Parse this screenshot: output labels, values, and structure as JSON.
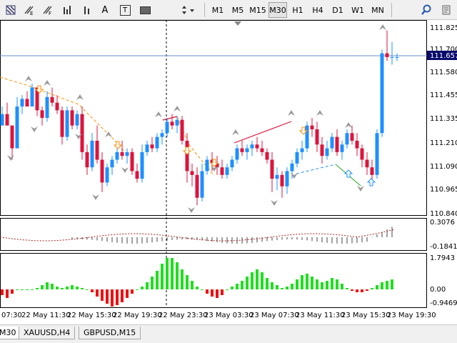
{
  "toolbar": {
    "tools": [
      {
        "name": "grid-tool-icon"
      },
      {
        "name": "text-e-icon",
        "label": "E"
      },
      {
        "name": "text-f-icon",
        "label": "F"
      },
      {
        "name": "bars-icon"
      },
      {
        "name": "label-a-icon",
        "label": "A"
      },
      {
        "name": "text-box-icon",
        "label": "T"
      },
      {
        "name": "rectangle-icon"
      },
      {
        "name": "arrows-icon"
      }
    ],
    "timeframes": [
      "M1",
      "M5",
      "M15",
      "M30",
      "H1",
      "H4",
      "D1",
      "W1",
      "MN"
    ],
    "active_timeframe": "M30",
    "search_icon": "search-icon",
    "zoom_icon": "zoom-icon"
  },
  "price_axis": {
    "ticks": [
      "111.825",
      "111.700",
      "111.580",
      "111.455",
      "111.335",
      "111.210",
      "111.090",
      "110.965",
      "110.840"
    ],
    "current_price": "111.657"
  },
  "osc1": {
    "ticks": [
      "0.3076",
      "-0.1841"
    ]
  },
  "osc2": {
    "ticks": [
      "1.7943",
      "0.00",
      "-0.9469"
    ]
  },
  "time_axis": {
    "labels": [
      "07:30",
      "22 May 11:30",
      "22 May 15:30",
      "22 May 19:30",
      "22 May 23:30",
      "23 May 03:30",
      "23 May 07:30",
      "23 May 11:30",
      "23 May 15:30",
      "23 May 19:30"
    ]
  },
  "tabs": [
    {
      "label": "M30",
      "active": true
    },
    {
      "label": "XAUUSD,H4",
      "active": false
    },
    {
      "label": "GBPUSD,M15",
      "active": false
    }
  ],
  "colors": {
    "bull": "#1e90ff",
    "bear": "#dc143c",
    "up_hist": "#22dd22",
    "down_hist": "#ee1111",
    "dots": "#aa2222"
  },
  "chart_data": {
    "type": "candlestick",
    "symbol_timeframe": "M30",
    "ylim": [
      110.84,
      111.825
    ],
    "candles": [
      [
        111.3,
        111.4,
        111.3,
        111.36
      ],
      [
        111.36,
        111.42,
        111.3,
        111.3
      ],
      [
        111.3,
        111.3,
        111.12,
        111.18
      ],
      [
        111.18,
        111.45,
        111.18,
        111.4
      ],
      [
        111.4,
        111.46,
        111.36,
        111.44
      ],
      [
        111.44,
        111.48,
        111.4,
        111.4
      ],
      [
        111.4,
        111.52,
        111.4,
        111.5
      ],
      [
        111.5,
        111.5,
        111.35,
        111.38
      ],
      [
        111.38,
        111.4,
        111.3,
        111.34
      ],
      [
        111.34,
        111.48,
        111.32,
        111.45
      ],
      [
        111.45,
        111.5,
        111.4,
        111.42
      ],
      [
        111.42,
        111.46,
        111.36,
        111.38
      ],
      [
        111.38,
        111.4,
        111.2,
        111.24
      ],
      [
        111.24,
        111.4,
        111.22,
        111.38
      ],
      [
        111.38,
        111.4,
        111.28,
        111.3
      ],
      [
        111.3,
        111.38,
        111.28,
        111.36
      ],
      [
        111.36,
        111.4,
        111.12,
        111.16
      ],
      [
        111.16,
        111.2,
        111.04,
        111.08
      ],
      [
        111.08,
        111.26,
        111.06,
        111.22
      ],
      [
        111.22,
        111.3,
        111.1,
        111.12
      ],
      [
        111.12,
        111.16,
        110.95,
        111.0
      ],
      [
        111.0,
        111.1,
        110.98,
        111.08
      ],
      [
        111.08,
        111.14,
        111.04,
        111.12
      ],
      [
        111.12,
        111.18,
        111.1,
        111.16
      ],
      [
        111.16,
        111.22,
        111.12,
        111.14
      ],
      [
        111.14,
        111.18,
        111.1,
        111.16
      ],
      [
        111.16,
        111.18,
        111.04,
        111.06
      ],
      [
        111.06,
        111.1,
        111.0,
        111.02
      ],
      [
        111.02,
        111.2,
        111.0,
        111.16
      ],
      [
        111.16,
        111.22,
        111.14,
        111.2
      ],
      [
        111.2,
        111.24,
        111.16,
        111.18
      ],
      [
        111.18,
        111.26,
        111.16,
        111.24
      ],
      [
        111.24,
        111.28,
        111.2,
        111.26
      ],
      [
        111.26,
        111.34,
        111.24,
        111.32
      ],
      [
        111.32,
        111.36,
        111.28,
        111.3
      ],
      [
        111.3,
        111.35,
        111.26,
        111.33
      ],
      [
        111.33,
        111.35,
        111.2,
        111.22
      ],
      [
        111.22,
        111.26,
        111.0,
        111.06
      ],
      [
        111.06,
        111.1,
        110.98,
        111.04
      ],
      [
        111.04,
        111.08,
        110.88,
        110.92
      ],
      [
        110.92,
        111.1,
        110.9,
        111.06
      ],
      [
        111.06,
        111.14,
        111.04,
        111.12
      ],
      [
        111.12,
        111.16,
        111.06,
        111.1
      ],
      [
        111.1,
        111.14,
        111.04,
        111.08
      ],
      [
        111.08,
        111.12,
        111.02,
        111.04
      ],
      [
        111.04,
        111.1,
        111.02,
        111.08
      ],
      [
        111.08,
        111.14,
        111.06,
        111.12
      ],
      [
        111.12,
        111.2,
        111.1,
        111.18
      ],
      [
        111.18,
        111.22,
        111.14,
        111.16
      ],
      [
        111.16,
        111.2,
        111.12,
        111.18
      ],
      [
        111.18,
        111.22,
        111.14,
        111.2
      ],
      [
        111.2,
        111.24,
        111.16,
        111.18
      ],
      [
        111.18,
        111.22,
        111.14,
        111.16
      ],
      [
        111.16,
        111.18,
        111.1,
        111.12
      ],
      [
        111.12,
        111.16,
        110.95,
        111.02
      ],
      [
        111.02,
        111.08,
        110.96,
        111.04
      ],
      [
        111.04,
        111.06,
        110.92,
        110.98
      ],
      [
        110.98,
        111.08,
        110.94,
        111.06
      ],
      [
        111.06,
        111.12,
        111.02,
        111.1
      ],
      [
        111.1,
        111.18,
        111.08,
        111.16
      ],
      [
        111.16,
        111.22,
        111.12,
        111.18
      ],
      [
        111.18,
        111.32,
        111.16,
        111.3
      ],
      [
        111.3,
        111.34,
        111.24,
        111.28
      ],
      [
        111.28,
        111.32,
        111.16,
        111.2
      ],
      [
        111.2,
        111.24,
        111.1,
        111.14
      ],
      [
        111.14,
        111.22,
        111.12,
        111.18
      ],
      [
        111.18,
        111.26,
        111.16,
        111.24
      ],
      [
        111.24,
        111.28,
        111.14,
        111.16
      ],
      [
        111.16,
        111.22,
        111.12,
        111.2
      ],
      [
        111.2,
        111.28,
        111.18,
        111.26
      ],
      [
        111.26,
        111.3,
        111.2,
        111.22
      ],
      [
        111.22,
        111.26,
        111.14,
        111.18
      ],
      [
        111.18,
        111.2,
        111.08,
        111.12
      ],
      [
        111.12,
        111.16,
        111.04,
        111.08
      ],
      [
        111.08,
        111.12,
        111.0,
        111.04
      ],
      [
        111.04,
        111.28,
        111.02,
        111.26
      ],
      [
        111.26,
        111.7,
        111.24,
        111.68
      ],
      [
        111.68,
        111.8,
        111.64,
        111.66
      ],
      [
        111.66,
        111.74,
        111.62,
        111.66
      ],
      [
        111.66,
        111.68,
        111.64,
        111.66
      ]
    ]
  }
}
